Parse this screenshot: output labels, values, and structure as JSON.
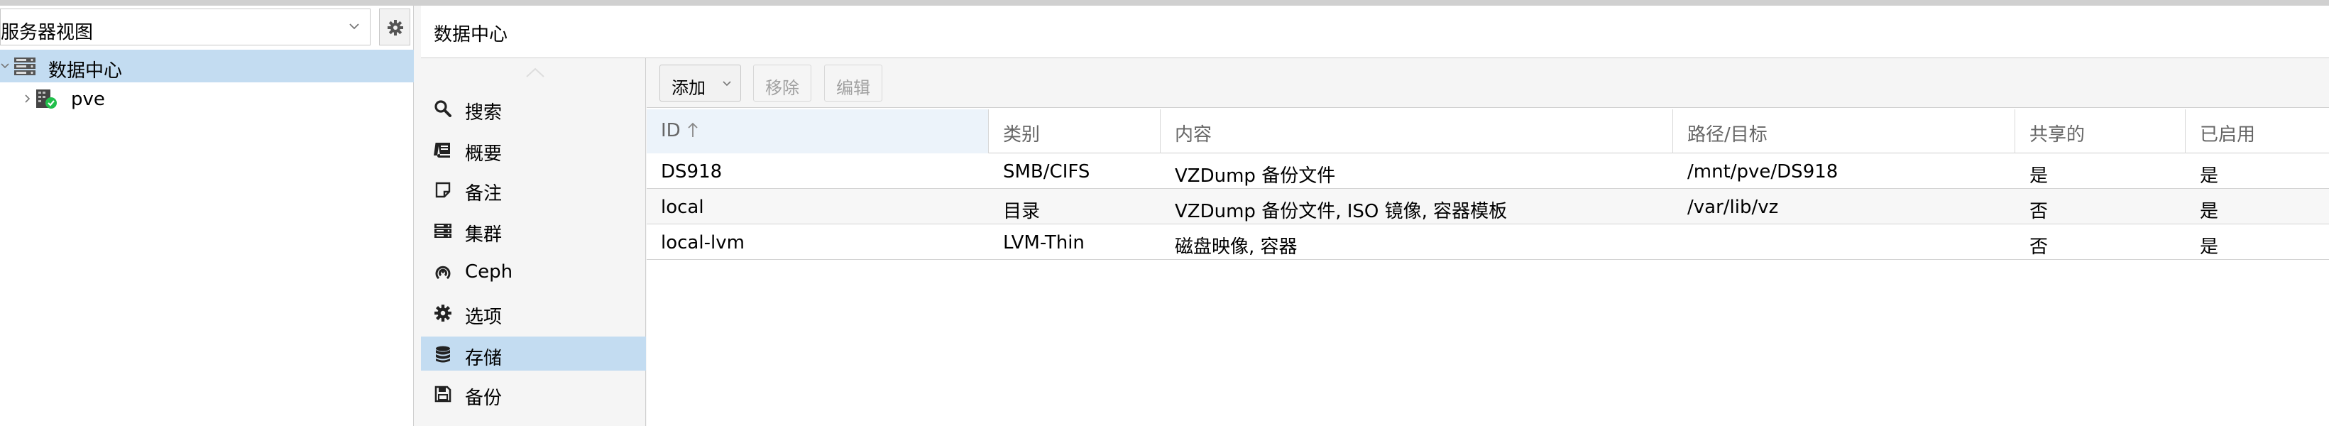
{
  "resource_tree": {
    "view_selector": {
      "value": "服务器视图"
    },
    "items": [
      {
        "label": "数据中心",
        "icon": "datacenter-icon",
        "selected": true
      },
      {
        "label": "pve",
        "icon": "node-icon",
        "status": "online"
      }
    ]
  },
  "header": {
    "title": "数据中心"
  },
  "nav": {
    "items": [
      {
        "label": "搜索",
        "icon": "search-icon"
      },
      {
        "label": "概要",
        "icon": "book-icon"
      },
      {
        "label": "备注",
        "icon": "notes-icon"
      },
      {
        "label": "集群",
        "icon": "server-icon"
      },
      {
        "label": "Ceph",
        "icon": "ceph-icon"
      },
      {
        "label": "选项",
        "icon": "gear-icon"
      },
      {
        "label": "存储",
        "icon": "database-icon",
        "selected": true
      },
      {
        "label": "备份",
        "icon": "save-icon"
      }
    ]
  },
  "toolbar": {
    "add_label": "添加",
    "remove_label": "移除",
    "edit_label": "编辑"
  },
  "table": {
    "columns": [
      "ID",
      "类别",
      "内容",
      "路径/目标",
      "共享的",
      "已启用"
    ],
    "rows": [
      [
        "DS918",
        "SMB/CIFS",
        "VZDump 备份文件",
        "/mnt/pve/DS918",
        "是",
        "是"
      ],
      [
        "local",
        "目录",
        "VZDump 备份文件, ISO 镜像, 容器模板",
        "/var/lib/vz",
        "否",
        "是"
      ],
      [
        "local-lvm",
        "LVM-Thin",
        "磁盘映像, 容器",
        "",
        "否",
        "是"
      ]
    ]
  },
  "colors": {
    "selection": "#c3dcf1",
    "status_ok": "#21bf4b"
  }
}
